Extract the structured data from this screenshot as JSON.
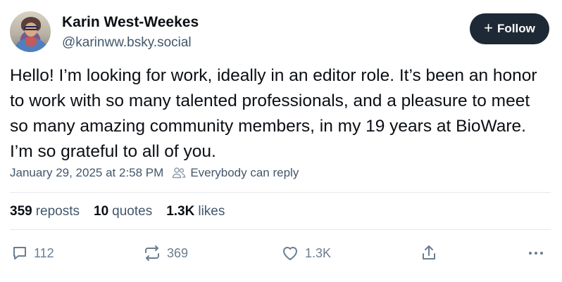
{
  "author": {
    "display_name": "Karin West-Weekes",
    "handle": "@karinww.bsky.social",
    "avatar_icon": "avatar"
  },
  "follow_button": {
    "label": "Follow",
    "icon": "plus-icon"
  },
  "post": {
    "text": "Hello! I’m looking for work, ideally in an editor role. It’s been an honor to work with so many talented professionals, and a pleasure to meet so many amazing community members, in my 19 years at BioWare. I’m so grateful to all of you."
  },
  "meta": {
    "timestamp": "January 29, 2025 at 2:58 PM",
    "reply_setting": "Everybody can reply"
  },
  "stats": {
    "reposts_count": "359",
    "reposts_label": "reposts",
    "quotes_count": "10",
    "quotes_label": "quotes",
    "likes_count": "1.3K",
    "likes_label": "likes"
  },
  "actions": {
    "replies": "112",
    "reposts": "369",
    "likes": "1.3K"
  },
  "colors": {
    "follow_bg": "#1e2936",
    "muted_text": "#42576c",
    "icon_gray": "#6b7d8f",
    "divider": "#e4e8ec"
  }
}
